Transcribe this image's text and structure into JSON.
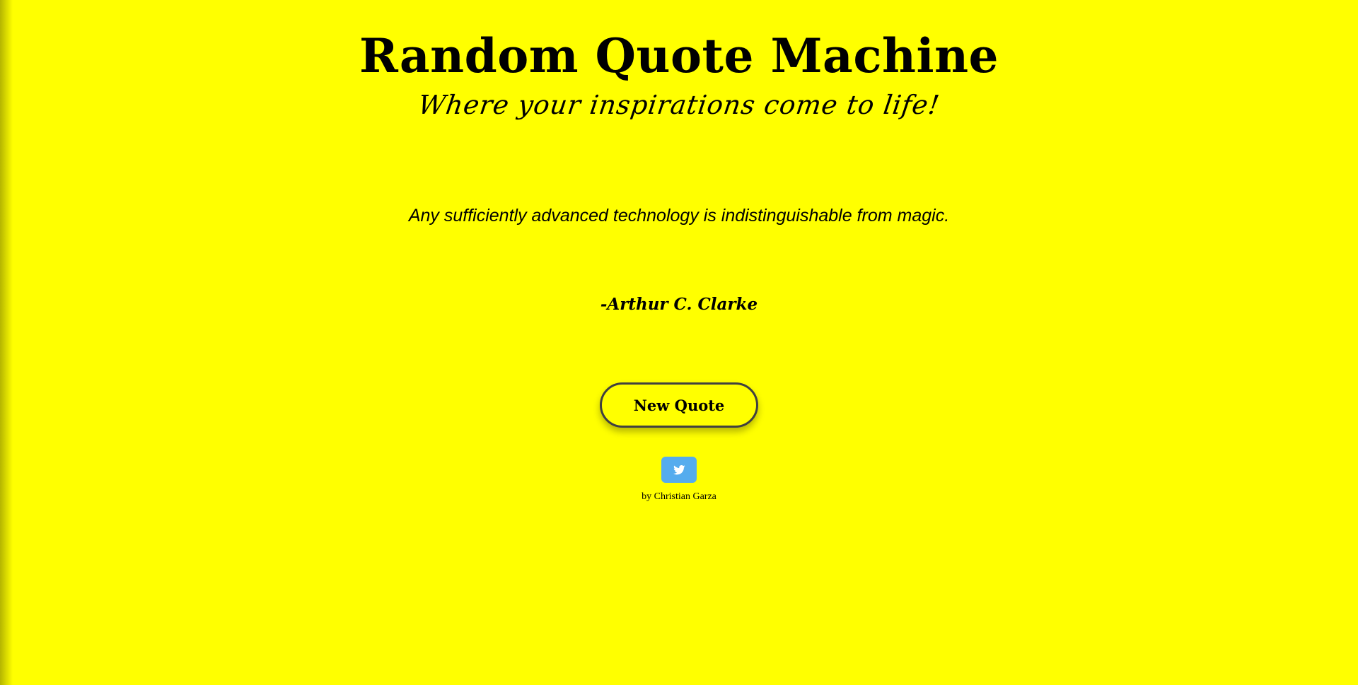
{
  "header": {
    "title": "Random Quote Machine",
    "subtitle": "Where your inspirations come to life!"
  },
  "quote": {
    "text": "Any sufficiently advanced technology is indistinguishable from magic.",
    "author": "-Arthur C. Clarke"
  },
  "actions": {
    "new_quote_label": "New Quote",
    "tweet_icon": "twitter-icon"
  },
  "footer": {
    "byline": "by Christian Garza"
  },
  "colors": {
    "background": "#ffff00",
    "tweet_button": "#55acee",
    "button_border": "#404040"
  }
}
